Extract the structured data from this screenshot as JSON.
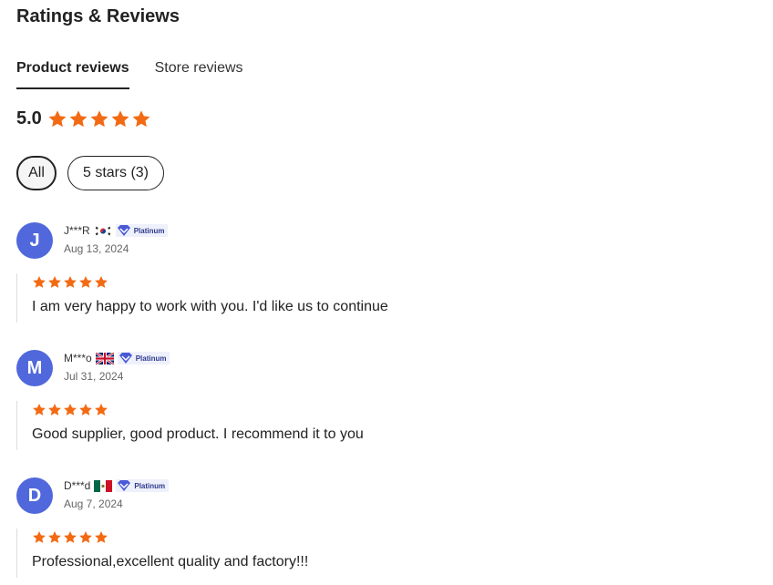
{
  "header": {
    "title": "Ratings & Reviews"
  },
  "tabs": [
    {
      "label": "Product reviews",
      "active": true
    },
    {
      "label": "Store reviews",
      "active": false
    }
  ],
  "rating": {
    "value": "5.0",
    "stars": 5,
    "star_color": "#f26a13"
  },
  "filters": [
    {
      "label": "All",
      "selected": true
    },
    {
      "label": "5 stars (3)",
      "selected": false
    }
  ],
  "reviews": [
    {
      "initial": "J",
      "name": "J***R",
      "flag": "south-korea-flag-icon",
      "badge": "Platinum",
      "date": "Aug 13, 2024",
      "stars": 5,
      "text": "I am very happy to work with you. I'd like us to continue"
    },
    {
      "initial": "M",
      "name": "M***o",
      "flag": "united-kingdom-flag-icon",
      "badge": "Platinum",
      "date": "Jul 31, 2024",
      "stars": 5,
      "text": "Good supplier, good product. I recommend it to you"
    },
    {
      "initial": "D",
      "name": "D***d",
      "flag": "mexico-flag-icon",
      "badge": "Platinum",
      "date": "Aug 7, 2024",
      "stars": 5,
      "text": "Professional,excellent quality and factory!!!"
    }
  ],
  "colors": {
    "avatar": "#5068db",
    "badge_diamond": "#4a5ad6"
  }
}
